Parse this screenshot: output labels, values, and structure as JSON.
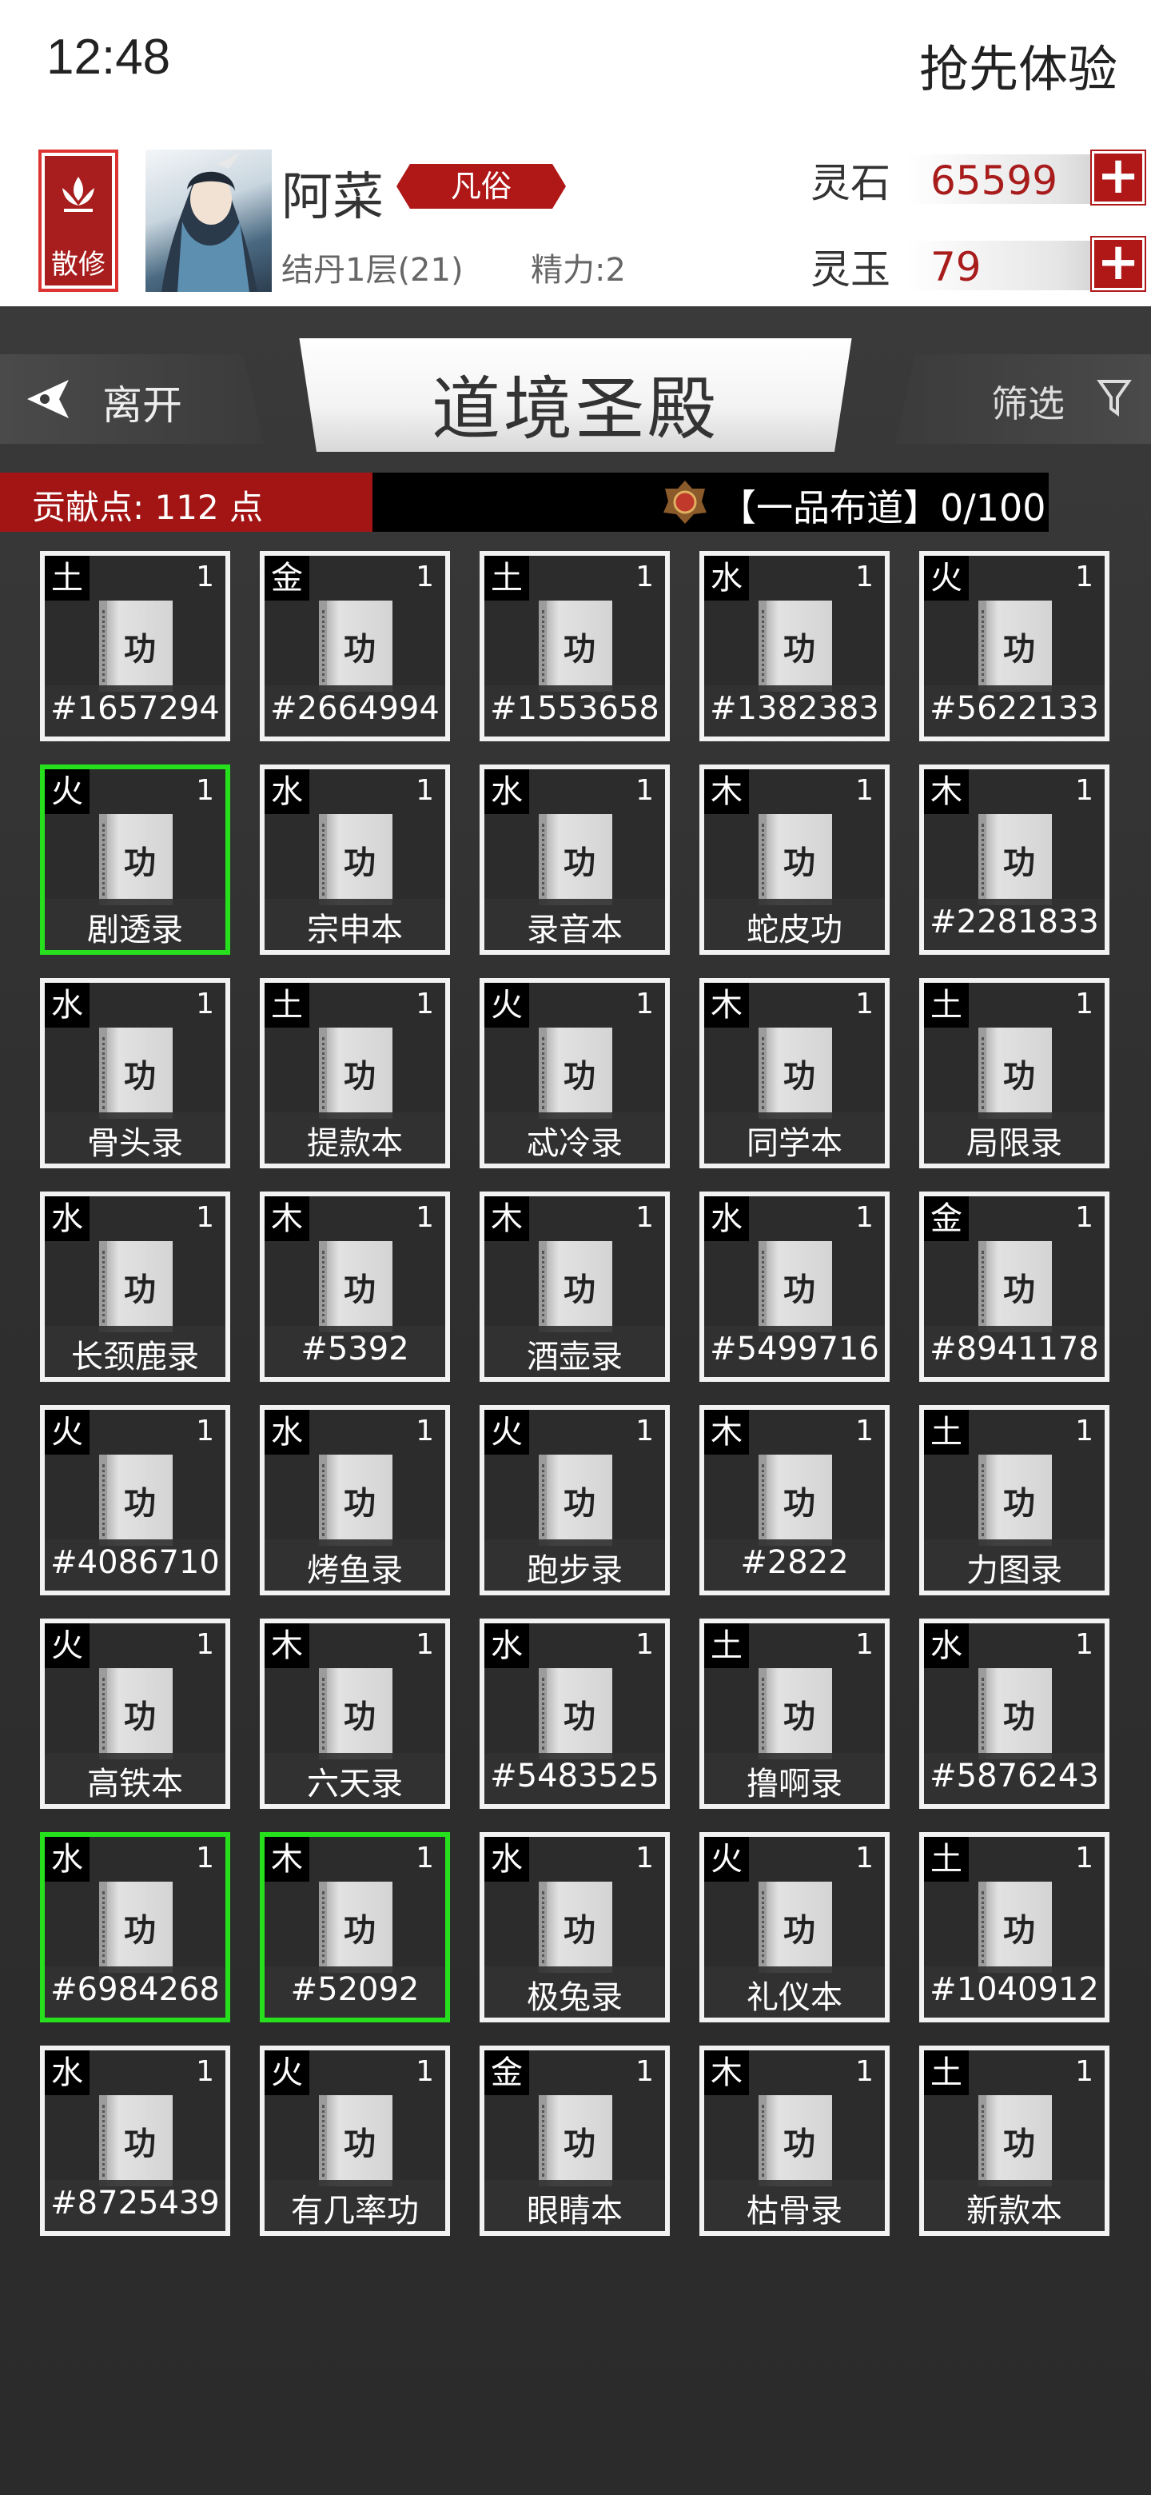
{
  "status_bar": {
    "time": "12:48",
    "trial_link": "抢先体验"
  },
  "player": {
    "sect": "散修",
    "name": "阿菜",
    "rank": "凡俗",
    "realm": "结丹1层(21)",
    "energy": "精力:2",
    "currencies": [
      {
        "label": "灵石",
        "value": "65599",
        "plus": "+"
      },
      {
        "label": "灵玉",
        "value": "79",
        "plus": "+"
      }
    ]
  },
  "nav": {
    "leave_label": "离开",
    "title": "道境圣殿",
    "filter_label": "筛选"
  },
  "contribution": {
    "points_text": "贡献点: 112 点",
    "quest_text": "【一品布道】0/100"
  },
  "book_glyph": "功",
  "colors": {
    "accent_red": "#a31515",
    "selected_border": "#26e01d",
    "card_border": "#f2f2f2"
  },
  "items": [
    {
      "element": "土",
      "qty": "1",
      "name": "#1657294",
      "selected": false
    },
    {
      "element": "金",
      "qty": "1",
      "name": "#2664994",
      "selected": false
    },
    {
      "element": "土",
      "qty": "1",
      "name": "#1553658",
      "selected": false
    },
    {
      "element": "水",
      "qty": "1",
      "name": "#1382383",
      "selected": false
    },
    {
      "element": "火",
      "qty": "1",
      "name": "#5622133",
      "selected": false
    },
    {
      "element": "火",
      "qty": "1",
      "name": "剧透录",
      "selected": true
    },
    {
      "element": "水",
      "qty": "1",
      "name": "宗申本",
      "selected": false
    },
    {
      "element": "水",
      "qty": "1",
      "name": "录音本",
      "selected": false
    },
    {
      "element": "木",
      "qty": "1",
      "name": "蛇皮功",
      "selected": false
    },
    {
      "element": "木",
      "qty": "1",
      "name": "#2281833",
      "selected": false
    },
    {
      "element": "水",
      "qty": "1",
      "name": "骨头录",
      "selected": false
    },
    {
      "element": "土",
      "qty": "1",
      "name": "提款本",
      "selected": false
    },
    {
      "element": "火",
      "qty": "1",
      "name": "忒冷录",
      "selected": false
    },
    {
      "element": "木",
      "qty": "1",
      "name": "同学本",
      "selected": false
    },
    {
      "element": "土",
      "qty": "1",
      "name": "局限录",
      "selected": false
    },
    {
      "element": "水",
      "qty": "1",
      "name": "长颈鹿录",
      "selected": false
    },
    {
      "element": "木",
      "qty": "1",
      "name": "#5392",
      "selected": false
    },
    {
      "element": "木",
      "qty": "1",
      "name": "酒壶录",
      "selected": false
    },
    {
      "element": "水",
      "qty": "1",
      "name": "#5499716",
      "selected": false
    },
    {
      "element": "金",
      "qty": "1",
      "name": "#8941178",
      "selected": false
    },
    {
      "element": "火",
      "qty": "1",
      "name": "#4086710",
      "selected": false
    },
    {
      "element": "水",
      "qty": "1",
      "name": "烤鱼录",
      "selected": false
    },
    {
      "element": "火",
      "qty": "1",
      "name": "跑步录",
      "selected": false
    },
    {
      "element": "木",
      "qty": "1",
      "name": "#2822",
      "selected": false
    },
    {
      "element": "土",
      "qty": "1",
      "name": "力图录",
      "selected": false
    },
    {
      "element": "火",
      "qty": "1",
      "name": "高铁本",
      "selected": false
    },
    {
      "element": "木",
      "qty": "1",
      "name": "六天录",
      "selected": false
    },
    {
      "element": "水",
      "qty": "1",
      "name": "#5483525",
      "selected": false
    },
    {
      "element": "土",
      "qty": "1",
      "name": "撸啊录",
      "selected": false
    },
    {
      "element": "水",
      "qty": "1",
      "name": "#5876243",
      "selected": false
    },
    {
      "element": "水",
      "qty": "1",
      "name": "#6984268",
      "selected": true
    },
    {
      "element": "木",
      "qty": "1",
      "name": "#52092",
      "selected": true
    },
    {
      "element": "水",
      "qty": "1",
      "name": "极兔录",
      "selected": false
    },
    {
      "element": "火",
      "qty": "1",
      "name": "礼仪本",
      "selected": false
    },
    {
      "element": "土",
      "qty": "1",
      "name": "#1040912",
      "selected": false
    },
    {
      "element": "水",
      "qty": "1",
      "name": "#8725439",
      "selected": false
    },
    {
      "element": "火",
      "qty": "1",
      "name": "有几率功",
      "selected": false
    },
    {
      "element": "金",
      "qty": "1",
      "name": "眼睛本",
      "selected": false
    },
    {
      "element": "木",
      "qty": "1",
      "name": "枯骨录",
      "selected": false
    },
    {
      "element": "土",
      "qty": "1",
      "name": "新款本",
      "selected": false
    }
  ]
}
